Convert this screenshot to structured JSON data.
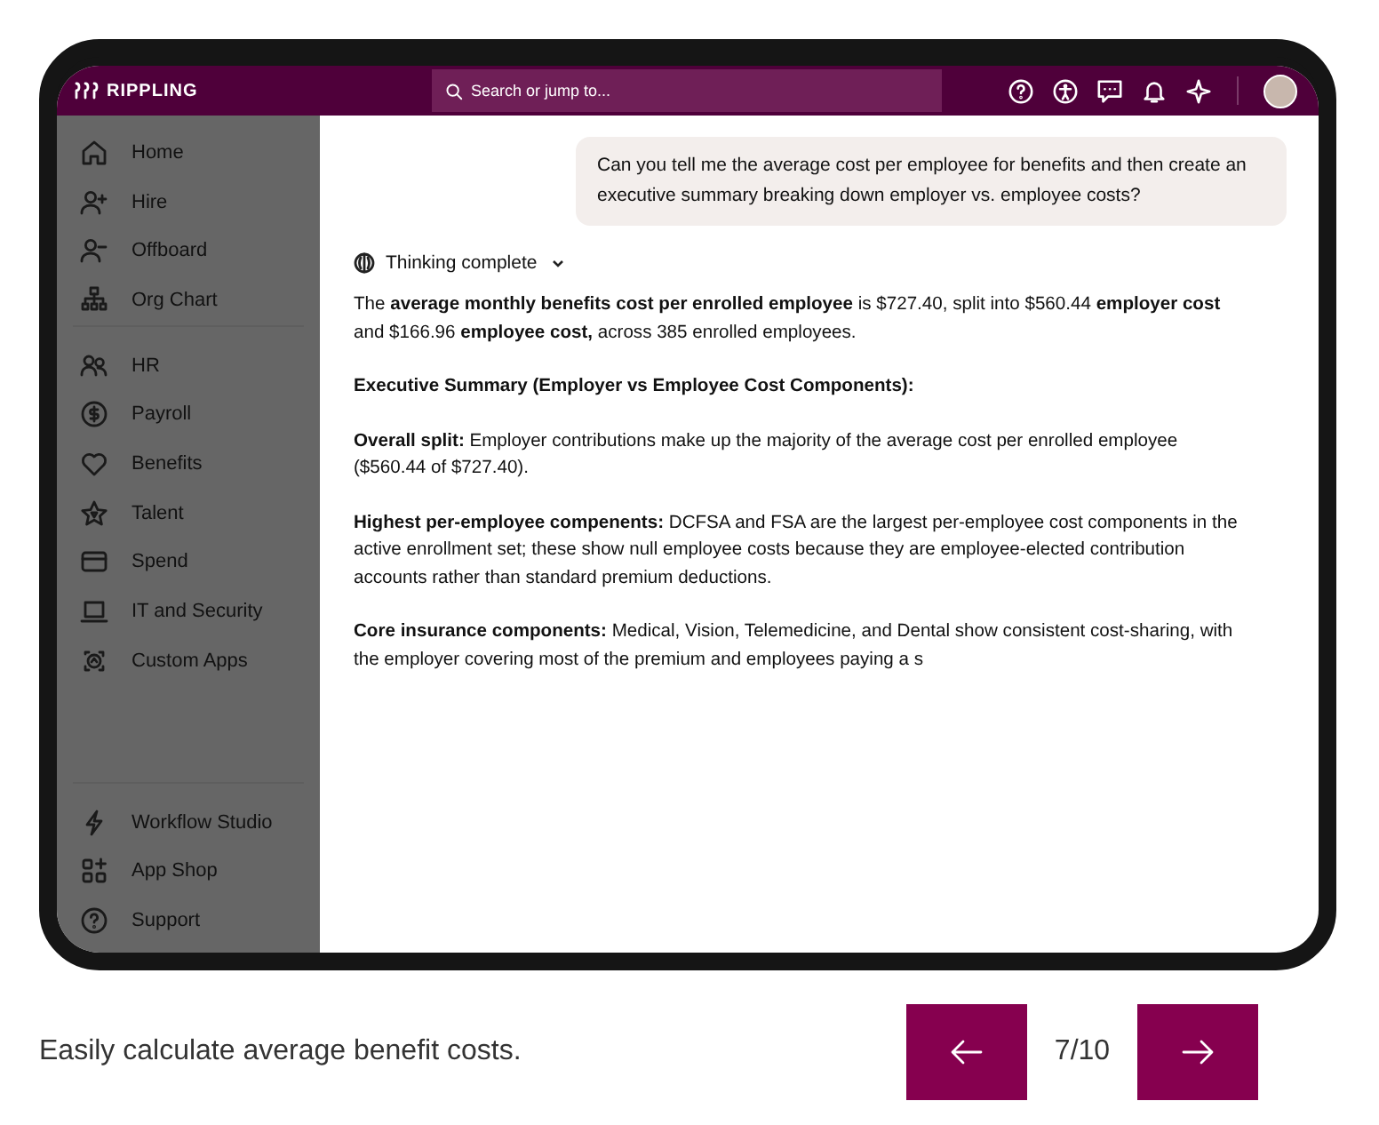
{
  "header": {
    "logo": "RIPPLING",
    "search": {
      "placeholder": "Search or jump to..."
    }
  },
  "sidebar": {
    "groups": [
      [
        {
          "label": "Home"
        },
        {
          "label": "Hire"
        },
        {
          "label": "Offboard"
        },
        {
          "label": "Org Chart"
        }
      ],
      [
        {
          "label": "HR"
        },
        {
          "label": "Payroll"
        },
        {
          "label": "Benefits"
        },
        {
          "label": "Talent"
        },
        {
          "label": "Spend"
        },
        {
          "label": "IT and Security"
        },
        {
          "label": "Custom Apps"
        }
      ],
      [
        {
          "label": "Workflow Studio"
        },
        {
          "label": "App Shop"
        },
        {
          "label": "Support"
        }
      ]
    ]
  },
  "chat": {
    "user_message": "Can you tell me the average cost per employee for benefits and then create an executive summary breaking down employer vs. employee costs?",
    "thinking": {
      "label": "Thinking complete",
      "expanded": false
    },
    "reply": [
      {
        "kind": "text",
        "text": "The **average monthly benefits cost per enrolled employee** is $727.40, split into $560.44 **employer cost** and $166.96 **employee cost,** across 385 enrolled employees."
      },
      {
        "kind": "heading",
        "text": "Executive Summary (Employer vs Employee Cost Components):"
      },
      {
        "kind": "text",
        "text": "**Overall split:** Employer contributions make up the majority of the average cost per enrolled employee ($560.44 of $727.40)."
      },
      {
        "kind": "text",
        "text": "**Highest per-employee compenents:** DCFSA and FSA are the largest per-employee cost components in the active enrollment set; these show null employee costs because they are employee-elected contribution accounts rather than standard premium deductions."
      },
      {
        "kind": "text",
        "text": "**Core insurance components:** Medical, Vision, Telemedicine, and Dental show consistent cost-sharing, with the employer covering most of the premium and employees paying a s"
      }
    ]
  },
  "caption": "Easily calculate average benefit costs.",
  "pager": {
    "position": "7/10"
  }
}
